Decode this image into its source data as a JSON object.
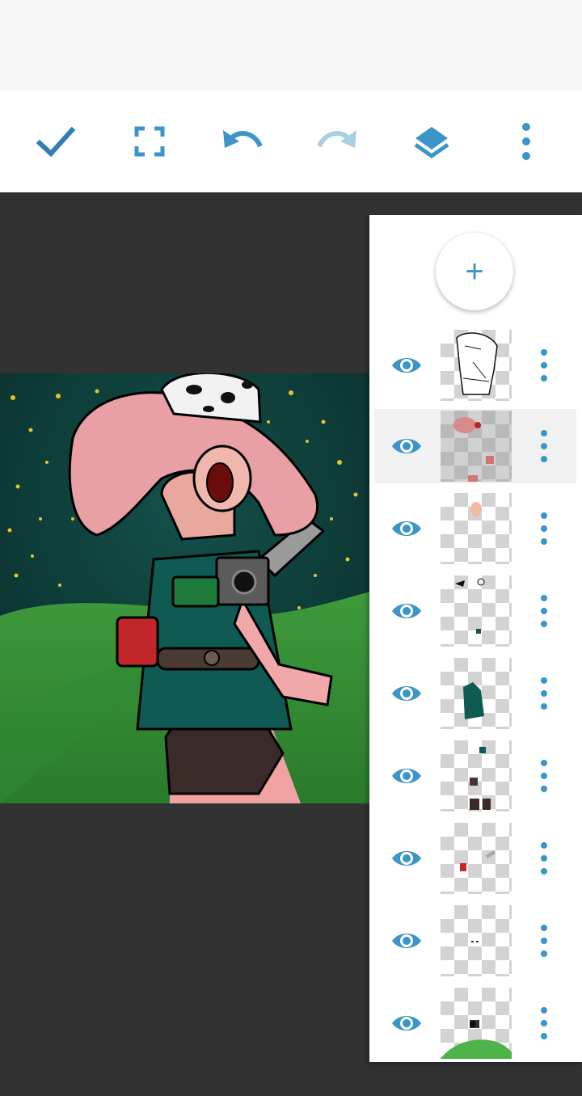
{
  "toolbar": {
    "confirm_icon": "checkmark-icon",
    "fullscreen_icon": "fullscreen-icon",
    "undo_icon": "undo-icon",
    "redo_icon": "redo-icon",
    "layers_icon": "layers-icon",
    "more_icon": "more-vertical-icon",
    "redo_enabled": false
  },
  "colors": {
    "accent": "#3b95c8",
    "accent_disabled": "#a9cfe4",
    "workspace": "#323232",
    "panel": "#ffffff",
    "selected_row": "#f1f1f1"
  },
  "layers_panel": {
    "add_label": "+",
    "selected_index": 1,
    "layers": [
      {
        "visible": true,
        "thumb": "lineart"
      },
      {
        "visible": true,
        "thumb": "shading"
      },
      {
        "visible": true,
        "thumb": "skin"
      },
      {
        "visible": true,
        "thumb": "details"
      },
      {
        "visible": true,
        "thumb": "jacket"
      },
      {
        "visible": true,
        "thumb": "shorts"
      },
      {
        "visible": true,
        "thumb": "props"
      },
      {
        "visible": true,
        "thumb": "small-marks"
      },
      {
        "visible": true,
        "thumb": "background"
      }
    ]
  }
}
